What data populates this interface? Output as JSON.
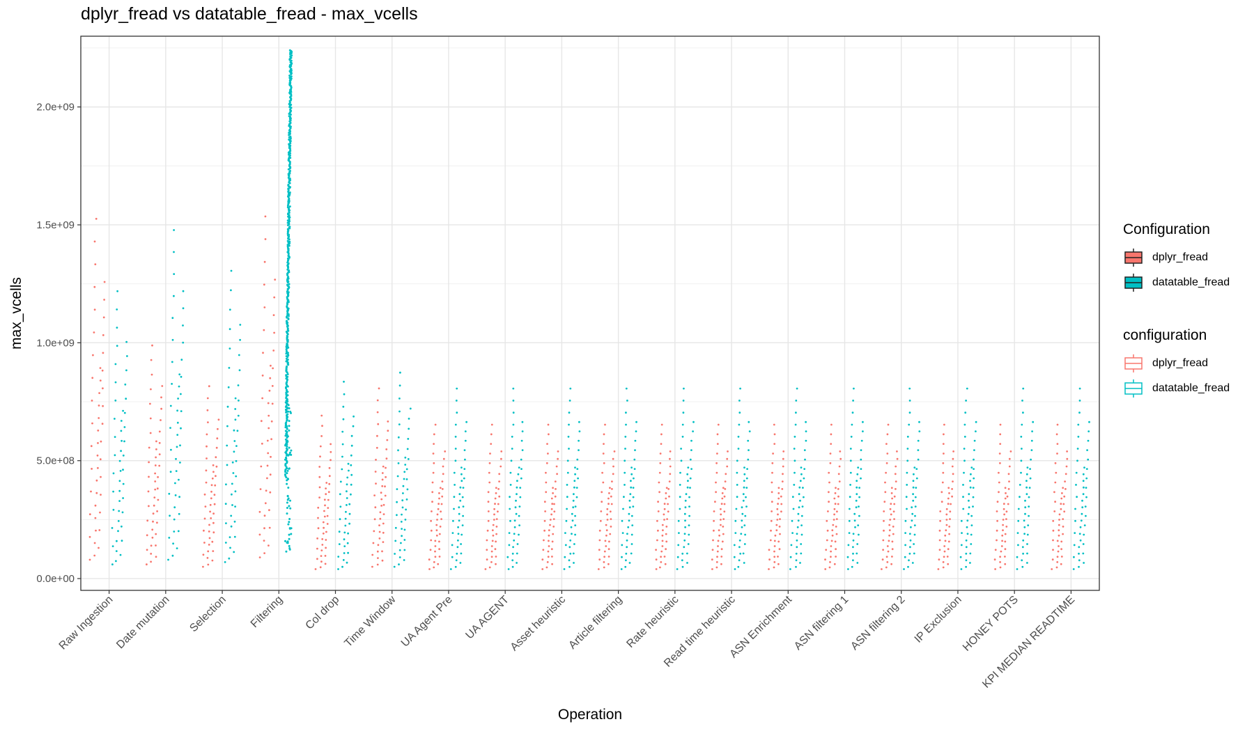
{
  "title": "dplyr_fread vs datatable_fread - max_vcells",
  "legends": [
    {
      "title": "Configuration",
      "style": "filled",
      "items": [
        {
          "label": "dplyr_fread",
          "color": "#F8766D"
        },
        {
          "label": "datatable_fread",
          "color": "#00BFC4"
        }
      ]
    },
    {
      "title": "configuration",
      "style": "outline",
      "items": [
        {
          "label": "dplyr_fread",
          "color": "#F8766D"
        },
        {
          "label": "datatable_fread",
          "color": "#00BFC4"
        }
      ]
    }
  ],
  "chart_data": {
    "type": "scatter",
    "title": "dplyr_fread vs datatable_fread - max_vcells",
    "xlabel": "Operation",
    "ylabel": "max_vcells",
    "ylim": [
      -50000000,
      2300000000
    ],
    "yticks": [
      0,
      500000000,
      1000000000,
      1500000000,
      2000000000
    ],
    "ytick_labels": [
      "0.0e+00",
      "5.0e+08",
      "1.0e+09",
      "1.5e+09",
      "2.0e+09"
    ],
    "grid": true,
    "legend_position": "right",
    "categories": [
      "Raw Ingestion",
      "Date mutation",
      "Selection",
      "Filtering",
      "Col drop",
      "Time Window",
      "UA Agent Pre",
      "UA AGENT",
      "Asset heuristic",
      "Article filtering",
      "Rate heuristic",
      "Read time heuristic",
      "ASN Enrichment",
      "ASN filtering 1",
      "ASN filtering 2",
      "IP Exclusion",
      "HONEY POTS",
      "KPI MEDIAN READTIME"
    ],
    "series": [
      {
        "name": "dplyr_fread",
        "color": "#F8766D",
        "ranges": [
          [
            80000000,
            1590000000
          ],
          [
            60000000,
            1030000000
          ],
          [
            50000000,
            850000000
          ],
          [
            90000000,
            1600000000
          ],
          [
            40000000,
            720000000
          ],
          [
            50000000,
            840000000
          ],
          [
            40000000,
            680000000
          ],
          [
            40000000,
            680000000
          ],
          [
            40000000,
            680000000
          ],
          [
            40000000,
            680000000
          ],
          [
            40000000,
            680000000
          ],
          [
            40000000,
            680000000
          ],
          [
            40000000,
            680000000
          ],
          [
            40000000,
            680000000
          ],
          [
            40000000,
            680000000
          ],
          [
            40000000,
            680000000
          ],
          [
            40000000,
            680000000
          ],
          [
            40000000,
            680000000
          ]
        ]
      },
      {
        "name": "datatable_fread",
        "color": "#00BFC4",
        "ranges": [
          [
            60000000,
            1270000000
          ],
          [
            80000000,
            1540000000
          ],
          [
            70000000,
            1360000000
          ],
          [
            110000000,
            2240000000
          ],
          [
            40000000,
            870000000
          ],
          [
            50000000,
            910000000
          ],
          [
            40000000,
            840000000
          ],
          [
            40000000,
            840000000
          ],
          [
            40000000,
            840000000
          ],
          [
            40000000,
            840000000
          ],
          [
            40000000,
            840000000
          ],
          [
            40000000,
            840000000
          ],
          [
            40000000,
            840000000
          ],
          [
            40000000,
            840000000
          ],
          [
            40000000,
            840000000
          ],
          [
            40000000,
            840000000
          ],
          [
            40000000,
            840000000
          ],
          [
            40000000,
            840000000
          ]
        ]
      }
    ]
  }
}
